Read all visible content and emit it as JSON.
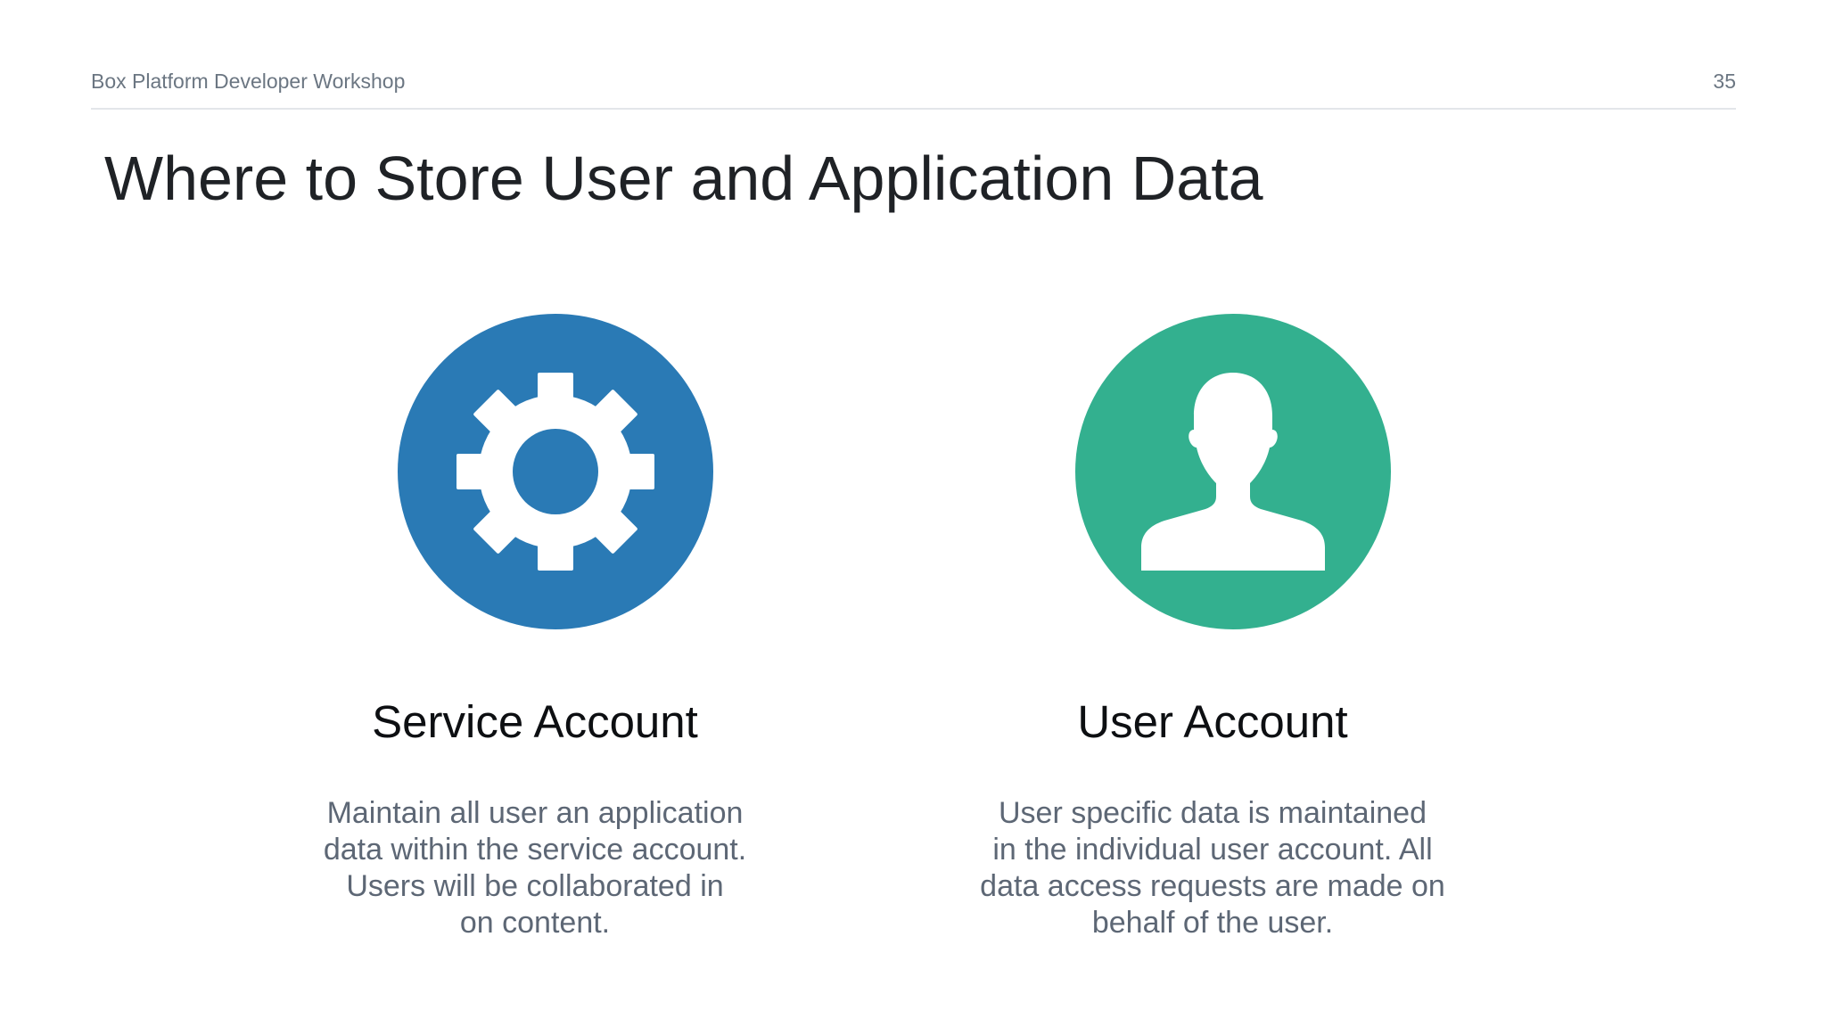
{
  "header": {
    "title": "Box Platform Developer Workshop",
    "slide_number": "35"
  },
  "page_title": "Where to Store User and Application Data",
  "cards": [
    {
      "icon": "gear-icon",
      "icon_bg": "#2a7ab5",
      "title": "Service Account",
      "lines": [
        "Maintain all user an application",
        "data within the service account.",
        "Users will be collaborated in",
        "on content."
      ]
    },
    {
      "icon": "user-icon",
      "icon_bg": "#33b08f",
      "title": "User Account",
      "lines": [
        "User specific data is maintained",
        "in the individual user account. All",
        "data access requests are made on",
        "behalf of the user."
      ]
    }
  ],
  "colors": {
    "icon_glyph": "#ffffff",
    "title_text": "#1f2226",
    "body_text": "#5d6775"
  }
}
